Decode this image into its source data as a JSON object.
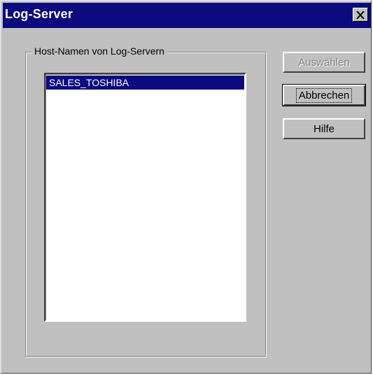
{
  "window": {
    "title": "Log-Server"
  },
  "group": {
    "label": "Host-Namen von Log-Servern"
  },
  "list": {
    "items": [
      "SALES_TOSHIBA"
    ],
    "selected_index": 0
  },
  "buttons": {
    "select": "Auswählen",
    "cancel": "Abbrechen",
    "help": "Hilfe"
  },
  "icons": {
    "close": "close-icon"
  },
  "colors": {
    "title_bar": "#0b0a7e",
    "face": "#c0c0c0",
    "selection": "#0b0a7e"
  }
}
